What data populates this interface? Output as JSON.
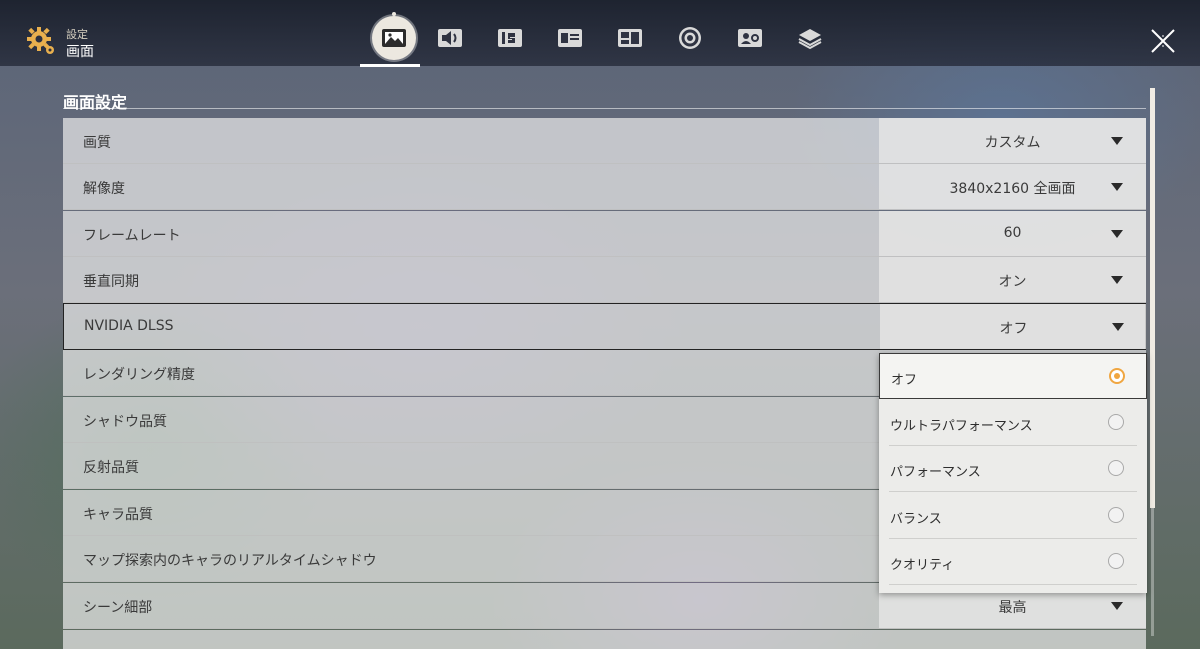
{
  "header": {
    "subtitle": "設定",
    "title": "画面",
    "tabs": [
      {
        "icon": "display-icon",
        "active": true
      },
      {
        "icon": "speaker-icon",
        "active": false
      },
      {
        "icon": "keybind-icon",
        "active": false
      },
      {
        "icon": "id-card-icon",
        "active": false
      },
      {
        "icon": "layout-icon",
        "active": false
      },
      {
        "icon": "lifebuoy-icon",
        "active": false
      },
      {
        "icon": "account-icon",
        "active": false
      },
      {
        "icon": "layers-icon",
        "active": false
      }
    ],
    "close_icon": "close-icon"
  },
  "section": {
    "title": "画面設定"
  },
  "settings": [
    {
      "label": "画質",
      "value": "カスタム"
    },
    {
      "label": "解像度",
      "value": "3840x2160 全画面"
    },
    {
      "label": "フレームレート",
      "value": "60"
    },
    {
      "label": "垂直同期",
      "value": "オン"
    },
    {
      "label": "NVIDIA DLSS",
      "value": "オフ",
      "selected": true
    },
    {
      "label": "レンダリング精度",
      "value": ""
    },
    {
      "label": "シャドウ品質",
      "value": ""
    },
    {
      "label": "反射品質",
      "value": ""
    },
    {
      "label": "キャラ品質",
      "value": ""
    },
    {
      "label": "マップ探索内のキャラのリアルタイムシャドウ",
      "value": ""
    },
    {
      "label": "シーン細部",
      "value": "最高"
    }
  ],
  "dropdown": {
    "options": [
      {
        "label": "オフ",
        "selected": true
      },
      {
        "label": "ウルトラパフォーマンス",
        "selected": false
      },
      {
        "label": "パフォーマンス",
        "selected": false
      },
      {
        "label": "バランス",
        "selected": false
      },
      {
        "label": "クオリティ",
        "selected": false
      }
    ]
  },
  "colors": {
    "accent": "#f0a641",
    "header_text": "#ffffff",
    "row_bg": "#ececec"
  }
}
